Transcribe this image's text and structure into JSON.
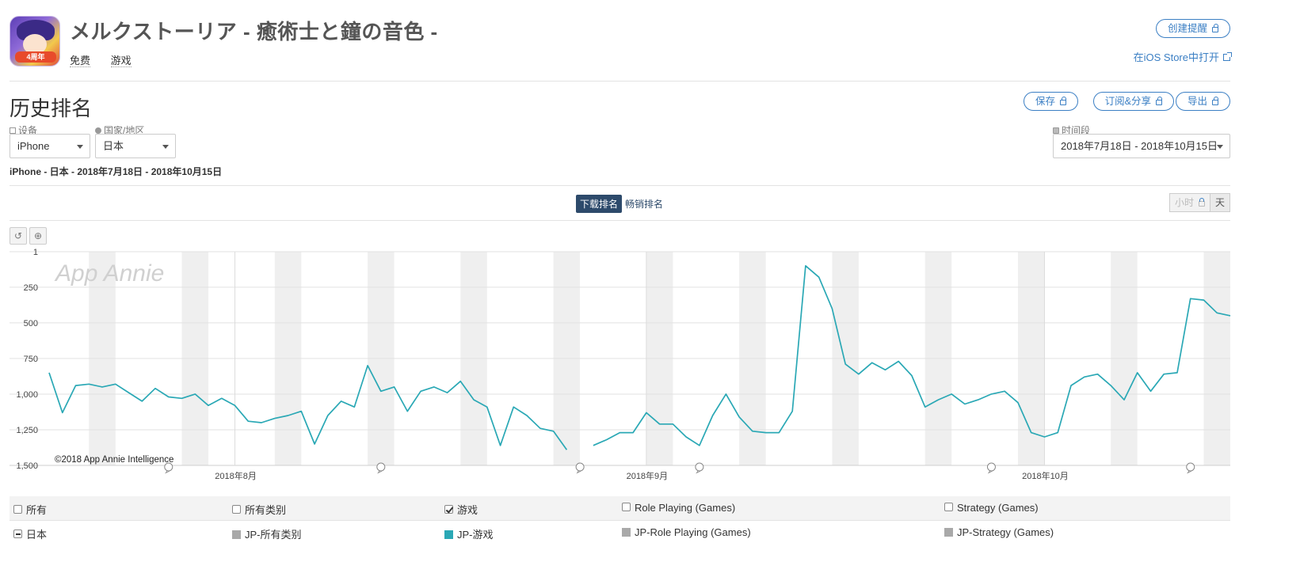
{
  "app": {
    "title": "メルクストーリア - 癒術士と鐘の音色 -",
    "price": "免费",
    "category": "游戏",
    "icon_badge": "4周年"
  },
  "header_actions": {
    "create_alert": "创建提醒",
    "open_ios_store": "在iOS Store中打开"
  },
  "section": {
    "title": "历史排名",
    "save": "保存",
    "subscribe_share": "订阅&分享",
    "export": "导出"
  },
  "filters": {
    "device_label": "设备",
    "device_value": "iPhone",
    "country_label": "国家/地区",
    "country_value": "日本",
    "period_label": "时间段",
    "period_value": "2018年7月18日 - 2018年10月15日"
  },
  "subtitle": "iPhone - 日本 - 2018年7月18日 - 2018年10月15日",
  "rank_tabs": {
    "download": "下载排名",
    "grossing": "畅销排名"
  },
  "granularity": {
    "hour": "小时",
    "day": "天"
  },
  "chart_tools": {
    "reset": "↺",
    "zoom": "⊕"
  },
  "watermark": "App Annie",
  "copyright": "©2018 App Annie Intelligence",
  "chart_data": {
    "type": "line",
    "y_inverted": true,
    "ylim": [
      1,
      1500
    ],
    "y_ticks": [
      "1",
      "250",
      "500",
      "750",
      "1,000",
      "1,250",
      "1,500"
    ],
    "y_tick_values": [
      1,
      250,
      500,
      750,
      1000,
      1250,
      1500
    ],
    "x_start": "2018-07-18",
    "x_end": "2018-10-15",
    "x_ticks": [
      {
        "date": "2018-08-01",
        "label": "2018年8月"
      },
      {
        "date": "2018-09-01",
        "label": "2018年9月"
      },
      {
        "date": "2018-10-01",
        "label": "2018年10月"
      }
    ],
    "weekend_dates": [
      "2018-07-21",
      "2018-07-28",
      "2018-08-04",
      "2018-08-11",
      "2018-08-18",
      "2018-08-25",
      "2018-09-01",
      "2018-09-08",
      "2018-09-15",
      "2018-09-22",
      "2018-09-29",
      "2018-10-06",
      "2018-10-13"
    ],
    "event_markers": [
      "2018-07-27",
      "2018-08-12",
      "2018-08-27",
      "2018-09-05",
      "2018-09-27",
      "2018-10-12"
    ],
    "grid": true,
    "series": [
      {
        "name": "JP-游戏",
        "color": "#2aa8b5",
        "points": [
          [
            "2018-07-18",
            850
          ],
          [
            "2018-07-19",
            1130
          ],
          [
            "2018-07-20",
            940
          ],
          [
            "2018-07-21",
            930
          ],
          [
            "2018-07-22",
            950
          ],
          [
            "2018-07-23",
            930
          ],
          [
            "2018-07-24",
            990
          ],
          [
            "2018-07-25",
            1050
          ],
          [
            "2018-07-26",
            960
          ],
          [
            "2018-07-27",
            1020
          ],
          [
            "2018-07-28",
            1030
          ],
          [
            "2018-07-29",
            1000
          ],
          [
            "2018-07-30",
            1080
          ],
          [
            "2018-07-31",
            1030
          ],
          [
            "2018-08-01",
            1080
          ],
          [
            "2018-08-02",
            1190
          ],
          [
            "2018-08-03",
            1200
          ],
          [
            "2018-08-04",
            1170
          ],
          [
            "2018-08-05",
            1150
          ],
          [
            "2018-08-06",
            1120
          ],
          [
            "2018-08-07",
            1350
          ],
          [
            "2018-08-08",
            1150
          ],
          [
            "2018-08-09",
            1050
          ],
          [
            "2018-08-10",
            1090
          ],
          [
            "2018-08-11",
            800
          ],
          [
            "2018-08-12",
            980
          ],
          [
            "2018-08-13",
            950
          ],
          [
            "2018-08-14",
            1120
          ],
          [
            "2018-08-15",
            980
          ],
          [
            "2018-08-16",
            950
          ],
          [
            "2018-08-17",
            990
          ],
          [
            "2018-08-18",
            910
          ],
          [
            "2018-08-19",
            1040
          ],
          [
            "2018-08-20",
            1090
          ],
          [
            "2018-08-21",
            1360
          ],
          [
            "2018-08-22",
            1090
          ],
          [
            "2018-08-23",
            1150
          ],
          [
            "2018-08-24",
            1240
          ],
          [
            "2018-08-25",
            1260
          ],
          [
            "2018-08-26",
            1390
          ],
          [
            "2018-08-28",
            1360
          ],
          [
            "2018-08-29",
            1320
          ],
          [
            "2018-08-30",
            1270
          ],
          [
            "2018-08-31",
            1270
          ],
          [
            "2018-09-01",
            1130
          ],
          [
            "2018-09-02",
            1210
          ],
          [
            "2018-09-03",
            1210
          ],
          [
            "2018-09-04",
            1300
          ],
          [
            "2018-09-05",
            1360
          ],
          [
            "2018-09-06",
            1150
          ],
          [
            "2018-09-07",
            1000
          ],
          [
            "2018-09-08",
            1160
          ],
          [
            "2018-09-09",
            1260
          ],
          [
            "2018-09-10",
            1270
          ],
          [
            "2018-09-11",
            1270
          ],
          [
            "2018-09-12",
            1120
          ],
          [
            "2018-09-13",
            100
          ],
          [
            "2018-09-14",
            180
          ],
          [
            "2018-09-15",
            400
          ],
          [
            "2018-09-16",
            790
          ],
          [
            "2018-09-17",
            860
          ],
          [
            "2018-09-18",
            780
          ],
          [
            "2018-09-19",
            830
          ],
          [
            "2018-09-20",
            770
          ],
          [
            "2018-09-21",
            870
          ],
          [
            "2018-09-22",
            1090
          ],
          [
            "2018-09-23",
            1040
          ],
          [
            "2018-09-24",
            1000
          ],
          [
            "2018-09-25",
            1070
          ],
          [
            "2018-09-26",
            1040
          ],
          [
            "2018-09-27",
            1000
          ],
          [
            "2018-09-28",
            980
          ],
          [
            "2018-09-29",
            1060
          ],
          [
            "2018-09-30",
            1270
          ],
          [
            "2018-10-01",
            1300
          ],
          [
            "2018-10-02",
            1270
          ],
          [
            "2018-10-03",
            940
          ],
          [
            "2018-10-04",
            880
          ],
          [
            "2018-10-05",
            860
          ],
          [
            "2018-10-06",
            940
          ],
          [
            "2018-10-07",
            1040
          ],
          [
            "2018-10-08",
            850
          ],
          [
            "2018-10-09",
            980
          ],
          [
            "2018-10-10",
            860
          ],
          [
            "2018-10-11",
            850
          ],
          [
            "2018-10-12",
            330
          ],
          [
            "2018-10-13",
            340
          ],
          [
            "2018-10-14",
            430
          ],
          [
            "2018-10-15",
            450
          ]
        ]
      }
    ]
  },
  "legend": {
    "row1": [
      {
        "label": "所有",
        "checked": false
      },
      {
        "label": "所有类别",
        "checked": false
      },
      {
        "label": "游戏",
        "checked": true
      },
      {
        "label": "Role Playing (Games)",
        "checked": false
      },
      {
        "label": "Strategy (Games)",
        "checked": false
      }
    ],
    "row2": [
      {
        "label": "日本"
      },
      {
        "label": "JP-所有类别",
        "color": "#a9a9a9"
      },
      {
        "label": "JP-游戏",
        "color": "#2aa8b5"
      },
      {
        "label": "JP-Role Playing (Games)",
        "color": "#a9a9a9"
      },
      {
        "label": "JP-Strategy (Games)",
        "color": "#a9a9a9"
      }
    ]
  }
}
